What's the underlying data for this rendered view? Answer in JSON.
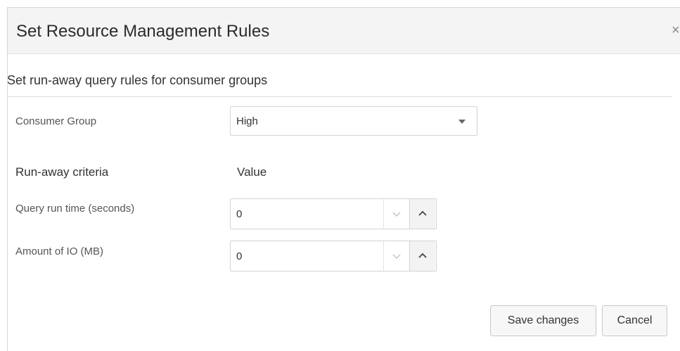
{
  "dialog": {
    "title": "Set Resource Management Rules",
    "close_glyph": "×"
  },
  "section": {
    "heading": "Set run-away query rules for consumer groups"
  },
  "consumer_group": {
    "label": "Consumer Group",
    "selected": "High"
  },
  "columns": {
    "criteria": "Run-away criteria",
    "value": "Value"
  },
  "rules": [
    {
      "label": "Query run time (seconds)",
      "value": "0"
    },
    {
      "label": "Amount of IO (MB)",
      "value": "0"
    }
  ],
  "buttons": {
    "save": "Save changes",
    "cancel": "Cancel"
  },
  "icons": {
    "close": "close-icon",
    "dropdown": "chevron-down-icon",
    "decrement": "chevron-down-icon",
    "increment": "chevron-up-icon"
  }
}
